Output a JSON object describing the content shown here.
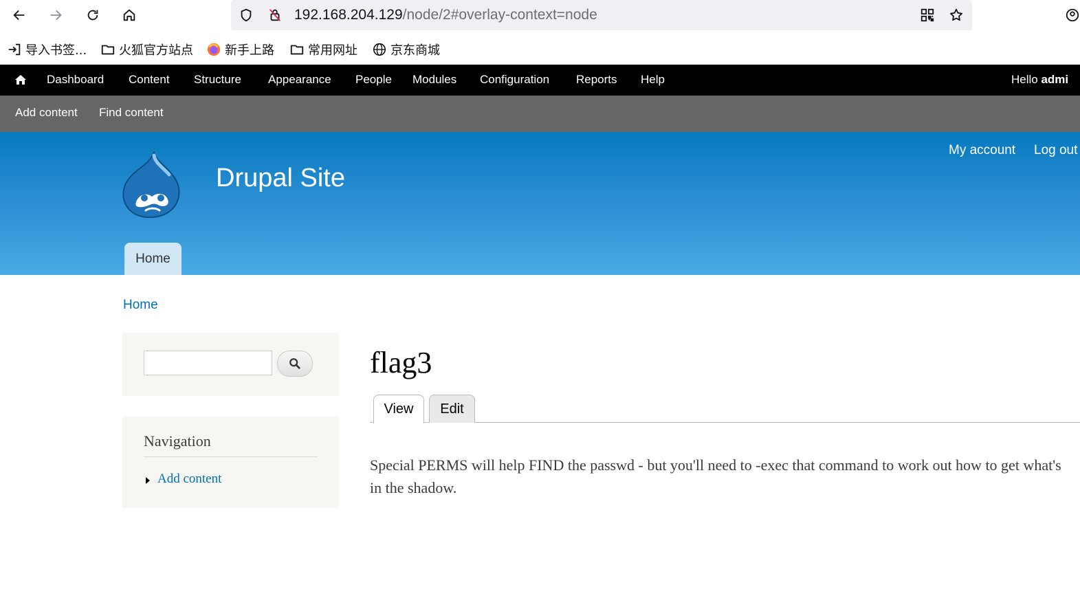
{
  "browser": {
    "url_host": "192.168.204.129",
    "url_path": "/node/2#overlay-context=node",
    "bookmarks": [
      {
        "label": "导入书签...",
        "icon": "import-icon"
      },
      {
        "label": "火狐官方站点",
        "icon": "folder-icon"
      },
      {
        "label": "新手上路",
        "icon": "firefox-icon"
      },
      {
        "label": "常用网址",
        "icon": "folder-icon"
      },
      {
        "label": "京东商城",
        "icon": "globe-icon"
      }
    ]
  },
  "admin_toolbar": {
    "items": [
      "Dashboard",
      "Content",
      "Structure",
      "Appearance",
      "People",
      "Modules",
      "Configuration",
      "Reports",
      "Help"
    ],
    "hello_prefix": "Hello ",
    "hello_user": "admi"
  },
  "shortcuts": [
    "Add content",
    "Find content"
  ],
  "header": {
    "site_name": "Drupal Site",
    "secondary_menu": [
      "My account",
      "Log out"
    ],
    "main_menu": [
      "Home"
    ]
  },
  "breadcrumb": "Home",
  "sidebar": {
    "navigation_title": "Navigation",
    "navigation_items": [
      "Add content"
    ]
  },
  "node": {
    "title": "flag3",
    "tabs": [
      "View",
      "Edit"
    ],
    "body": "Special PERMS will help FIND the passwd - but you'll need to -exec that command to work out how to get what's in the shadow."
  },
  "colors": {
    "admin_bar": "#000000",
    "shortcut_bar": "#666666",
    "header_top": "#0779bf",
    "header_bottom": "#48a9e4",
    "link": "#0071b3"
  }
}
